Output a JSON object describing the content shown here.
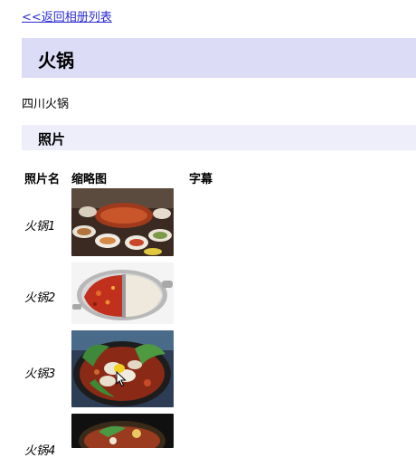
{
  "nav": {
    "back_label": "<<返回相册列表"
  },
  "album": {
    "title": "火锅",
    "description": "四川火锅"
  },
  "photos_section": {
    "heading": "照片"
  },
  "table": {
    "headers": {
      "name": "照片名",
      "thumbnail": "缩略图",
      "caption": "字幕"
    },
    "rows": [
      {
        "name": "火锅1",
        "caption": "",
        "thumbnail_icon": "hotpot-feast-thumbnail"
      },
      {
        "name": "火锅2",
        "caption": "",
        "thumbnail_icon": "split-pot-thumbnail"
      },
      {
        "name": "火锅3",
        "caption": "",
        "thumbnail_icon": "hotpot-greens-thumbnail"
      },
      {
        "name": "火锅4",
        "caption": "",
        "thumbnail_icon": "hotpot-dark-thumbnail"
      }
    ]
  },
  "colors": {
    "link": "#2b2bd0",
    "title_bg": "#dcdcf7",
    "section_bg": "#eeeefb"
  }
}
